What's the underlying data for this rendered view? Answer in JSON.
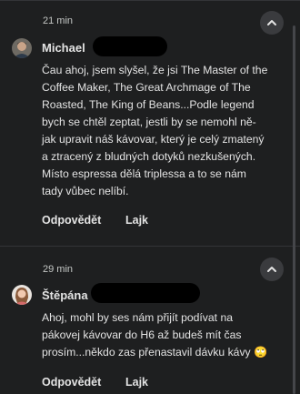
{
  "comments": [
    {
      "time": "21 min",
      "author": "Michael",
      "text": "Čau ahoj, jsem slyšel, že jsi The Master of the\nCoffee Maker, The Great Archmage of The\nRoasted, The King of Beans...Podle legend\nbych se chtěl zeptat, jestli by se nemohl ně-\njak upravit náš kávovar, který je celý zmatený\na ztracený z bludných dotyků nezkušených.\nMísto espressa dělá triplessa a to se nám\ntady vůbec nelíbí.",
      "reply_label": "Odpovědět",
      "like_label": "Lajk"
    },
    {
      "time": "29 min",
      "author": "Štěpána",
      "text": "Ahoj, mohl by ses nám přijít podívat na\npákovej kávovar do H6 až budeš mít čas\nprosím...někdo zas přenastavil dávku kávy 🙄",
      "reply_label": "Odpovědět",
      "like_label": "Lajk"
    }
  ],
  "icons": {
    "collapse": "chevron-up-icon"
  },
  "colors": {
    "background": "#1e1f20",
    "text": "#e3e3e3",
    "muted": "#c4c7c5",
    "button_bg": "#3a3b3e"
  }
}
